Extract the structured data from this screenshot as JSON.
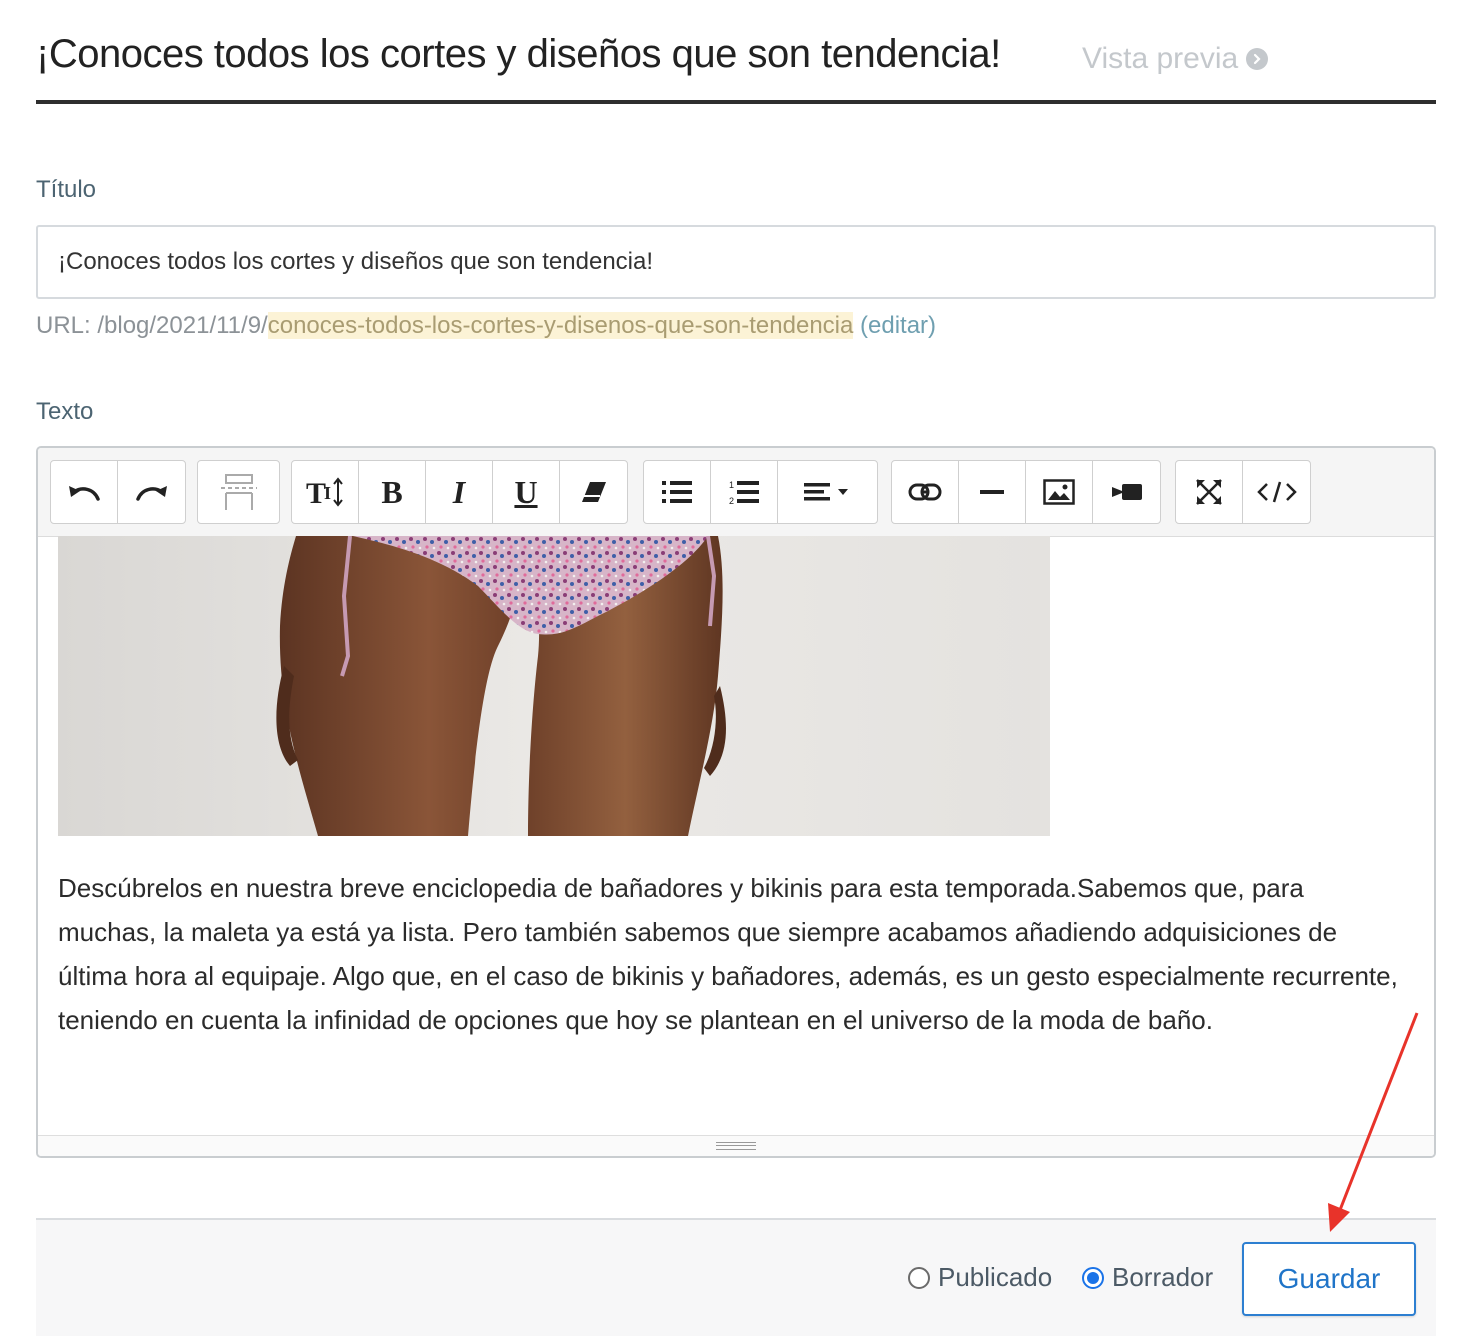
{
  "header": {
    "title": "¡Conoces todos los cortes y diseños que son tendencia!",
    "preview_label": "Vista previa"
  },
  "form": {
    "title_label": "Título",
    "title_value": "¡Conoces todos los cortes y diseños que son tendencia!",
    "url_prefix": "URL: /blog/2021/11/9/",
    "url_slug": "conoces-todos-los-cortes-y-disenos-que-son-tendencia",
    "url_edit": "(editar)",
    "text_label": "Texto"
  },
  "toolbar": {
    "groups": [
      [
        "undo-icon",
        "redo-icon"
      ],
      [
        "table-icon"
      ],
      [
        "text-size-icon",
        "bold-icon",
        "italic-icon",
        "underline-icon",
        "eraser-icon"
      ],
      [
        "bullet-list-icon",
        "numbered-list-icon",
        "align-dropdown-icon"
      ],
      [
        "link-icon",
        "horizontal-rule-icon",
        "image-icon",
        "video-icon"
      ],
      [
        "fullscreen-icon",
        "code-view-icon"
      ]
    ]
  },
  "editor": {
    "body_text": "Descúbrelos en nuestra breve enciclopedia de bañadores y bikinis para esta temporada.Sabemos que, para muchas, la maleta ya está ya lista. Pero también sabemos que siempre acabamos añadiendo adquisiciones de última hora al equipaje. Algo que, en el caso de bikinis y bañadores, además, es un gesto especialmente recurrente, teniendo en cuenta la infinidad de opciones que hoy se plantean en el universo de la moda de baño."
  },
  "footer": {
    "published_label": "Publicado",
    "draft_label": "Borrador",
    "selected_status": "Borrador",
    "save_label": "Guardar"
  },
  "colors": {
    "accent": "#1f74c8",
    "annotation_arrow": "#e8332a",
    "slug_highlight": "#fcf3d6"
  }
}
